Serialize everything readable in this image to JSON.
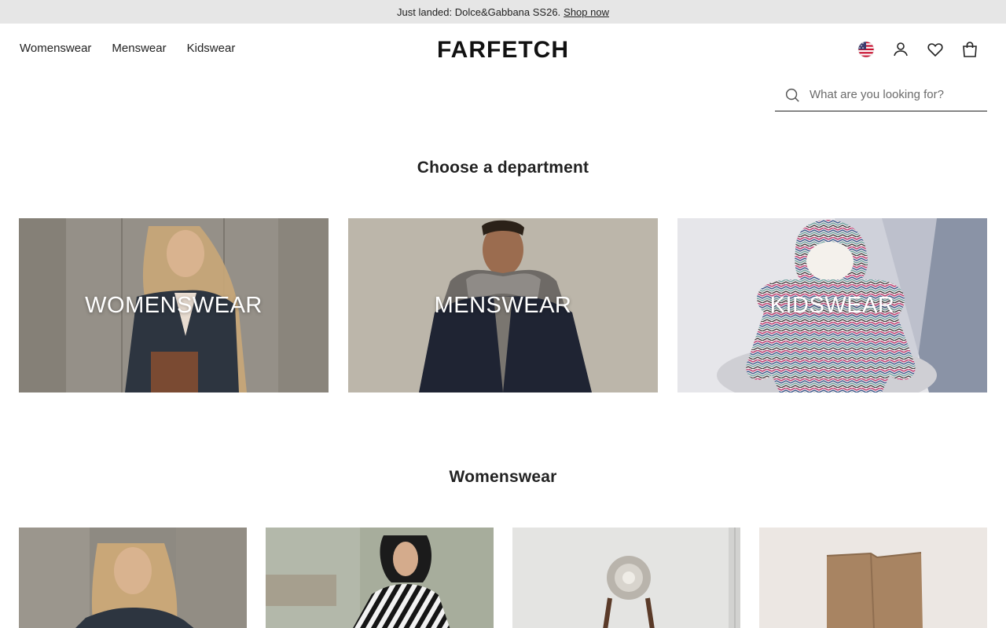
{
  "banner": {
    "text": "Just landed: Dolce&Gabbana SS26.",
    "link": "Shop now"
  },
  "nav": {
    "items": [
      "Womenswear",
      "Menswear",
      "Kidswear"
    ]
  },
  "logo": "FARFETCH",
  "header_icons": [
    "us-flag-icon",
    "account-icon",
    "wishlist-heart-icon",
    "shopping-bag-icon"
  ],
  "search": {
    "placeholder": "What are you looking for?"
  },
  "departments": {
    "title": "Choose a department",
    "items": [
      {
        "label": "WOMENSWEAR"
      },
      {
        "label": "MENSWEAR"
      },
      {
        "label": "KIDSWEAR"
      }
    ]
  },
  "womenswear_section": {
    "title": "Womenswear"
  },
  "colors": {
    "banner_bg": "#e6e6e6",
    "text": "#222222",
    "overlay_text": "#ffffff"
  }
}
